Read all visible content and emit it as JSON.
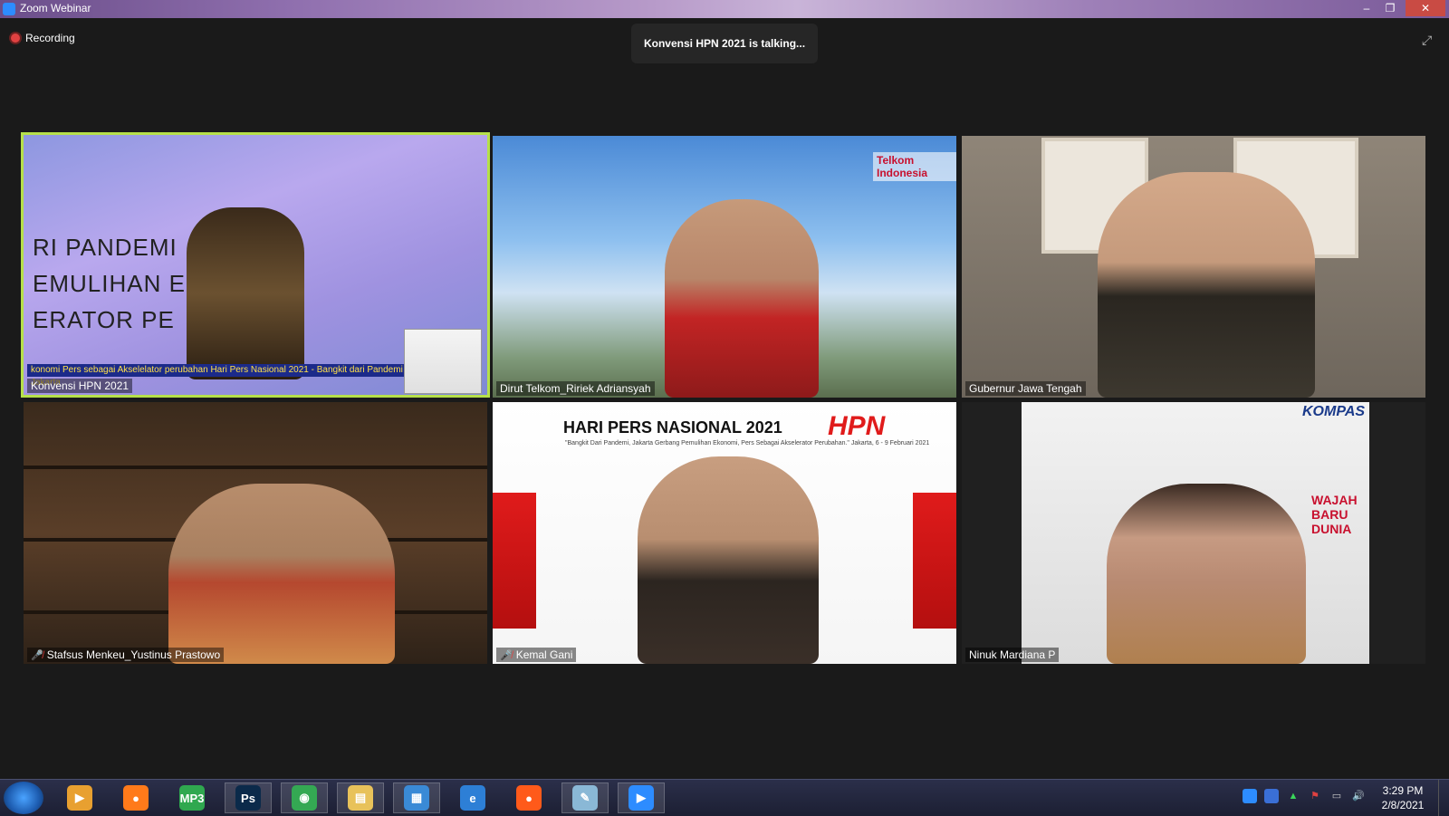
{
  "window": {
    "title": "Zoom Webinar",
    "controls": {
      "minimize": "–",
      "maximize": "❐",
      "close": "✕"
    }
  },
  "recording": {
    "label": "Recording"
  },
  "talking_banner": {
    "text": "Konvensi HPN 2021 is talking..."
  },
  "fullscreen_icon": "⤢",
  "tiles": [
    {
      "name": "Konvensi HPN 2021",
      "active_speaker": true,
      "slide_lines": [
        "RI PANDEMI",
        "EMULIHAN EKO",
        "ERATOR PE"
      ],
      "caption": "konomi Pers sebagai Akselelator perubahan Hari Pers Nasional 2021 - Bangkit dari Pandemi Jakarta"
    },
    {
      "name": "Dirut Telkom_Ririek Adriansyah",
      "muted": false,
      "brand": "Telkom Indonesia"
    },
    {
      "name": "Gubernur Jawa Tengah",
      "muted": false
    },
    {
      "name": "Stafsus Menkeu_Yustinus Prastowo",
      "muted": true
    },
    {
      "name": "Kemal Gani",
      "muted": true,
      "banner_title": "HARI PERS NASIONAL 2021",
      "banner_sub": "\"Bangkit Dari Pandemi, Jakarta Gerbang Pemulihan Ekonomi, Pers Sebagai Akselerator Perubahan.\" Jakarta, 6 - 9 Februari 2021",
      "logo": "HPN"
    },
    {
      "name": "Ninuk Mardiana P",
      "muted": false,
      "masthead": "KOMPAS",
      "headline": "WAJAH BARU DUNIA"
    }
  ],
  "taskbar": {
    "apps": [
      {
        "name": "media-player",
        "glyph": "▶",
        "color": "#e8a030"
      },
      {
        "name": "firefox",
        "glyph": "●",
        "color": "#ff7a1a"
      },
      {
        "name": "mp3-tool",
        "glyph": "MP3",
        "color": "#2fa84f"
      },
      {
        "name": "photoshop",
        "glyph": "Ps",
        "color": "#0b2a4a"
      },
      {
        "name": "chrome",
        "glyph": "◉",
        "color": "#34a853"
      },
      {
        "name": "file-explorer",
        "glyph": "▤",
        "color": "#e8c25a"
      },
      {
        "name": "image-viewer",
        "glyph": "▦",
        "color": "#3a8ad6"
      },
      {
        "name": "internet-explorer",
        "glyph": "e",
        "color": "#2d7fd6"
      },
      {
        "name": "firefox-2",
        "glyph": "●",
        "color": "#ff5a1a"
      },
      {
        "name": "notepad",
        "glyph": "✎",
        "color": "#8ab8d6"
      },
      {
        "name": "zoom",
        "glyph": "▶",
        "color": "#2d8cff"
      }
    ],
    "clock": {
      "time": "3:29 PM",
      "date": "2/8/2021"
    }
  }
}
